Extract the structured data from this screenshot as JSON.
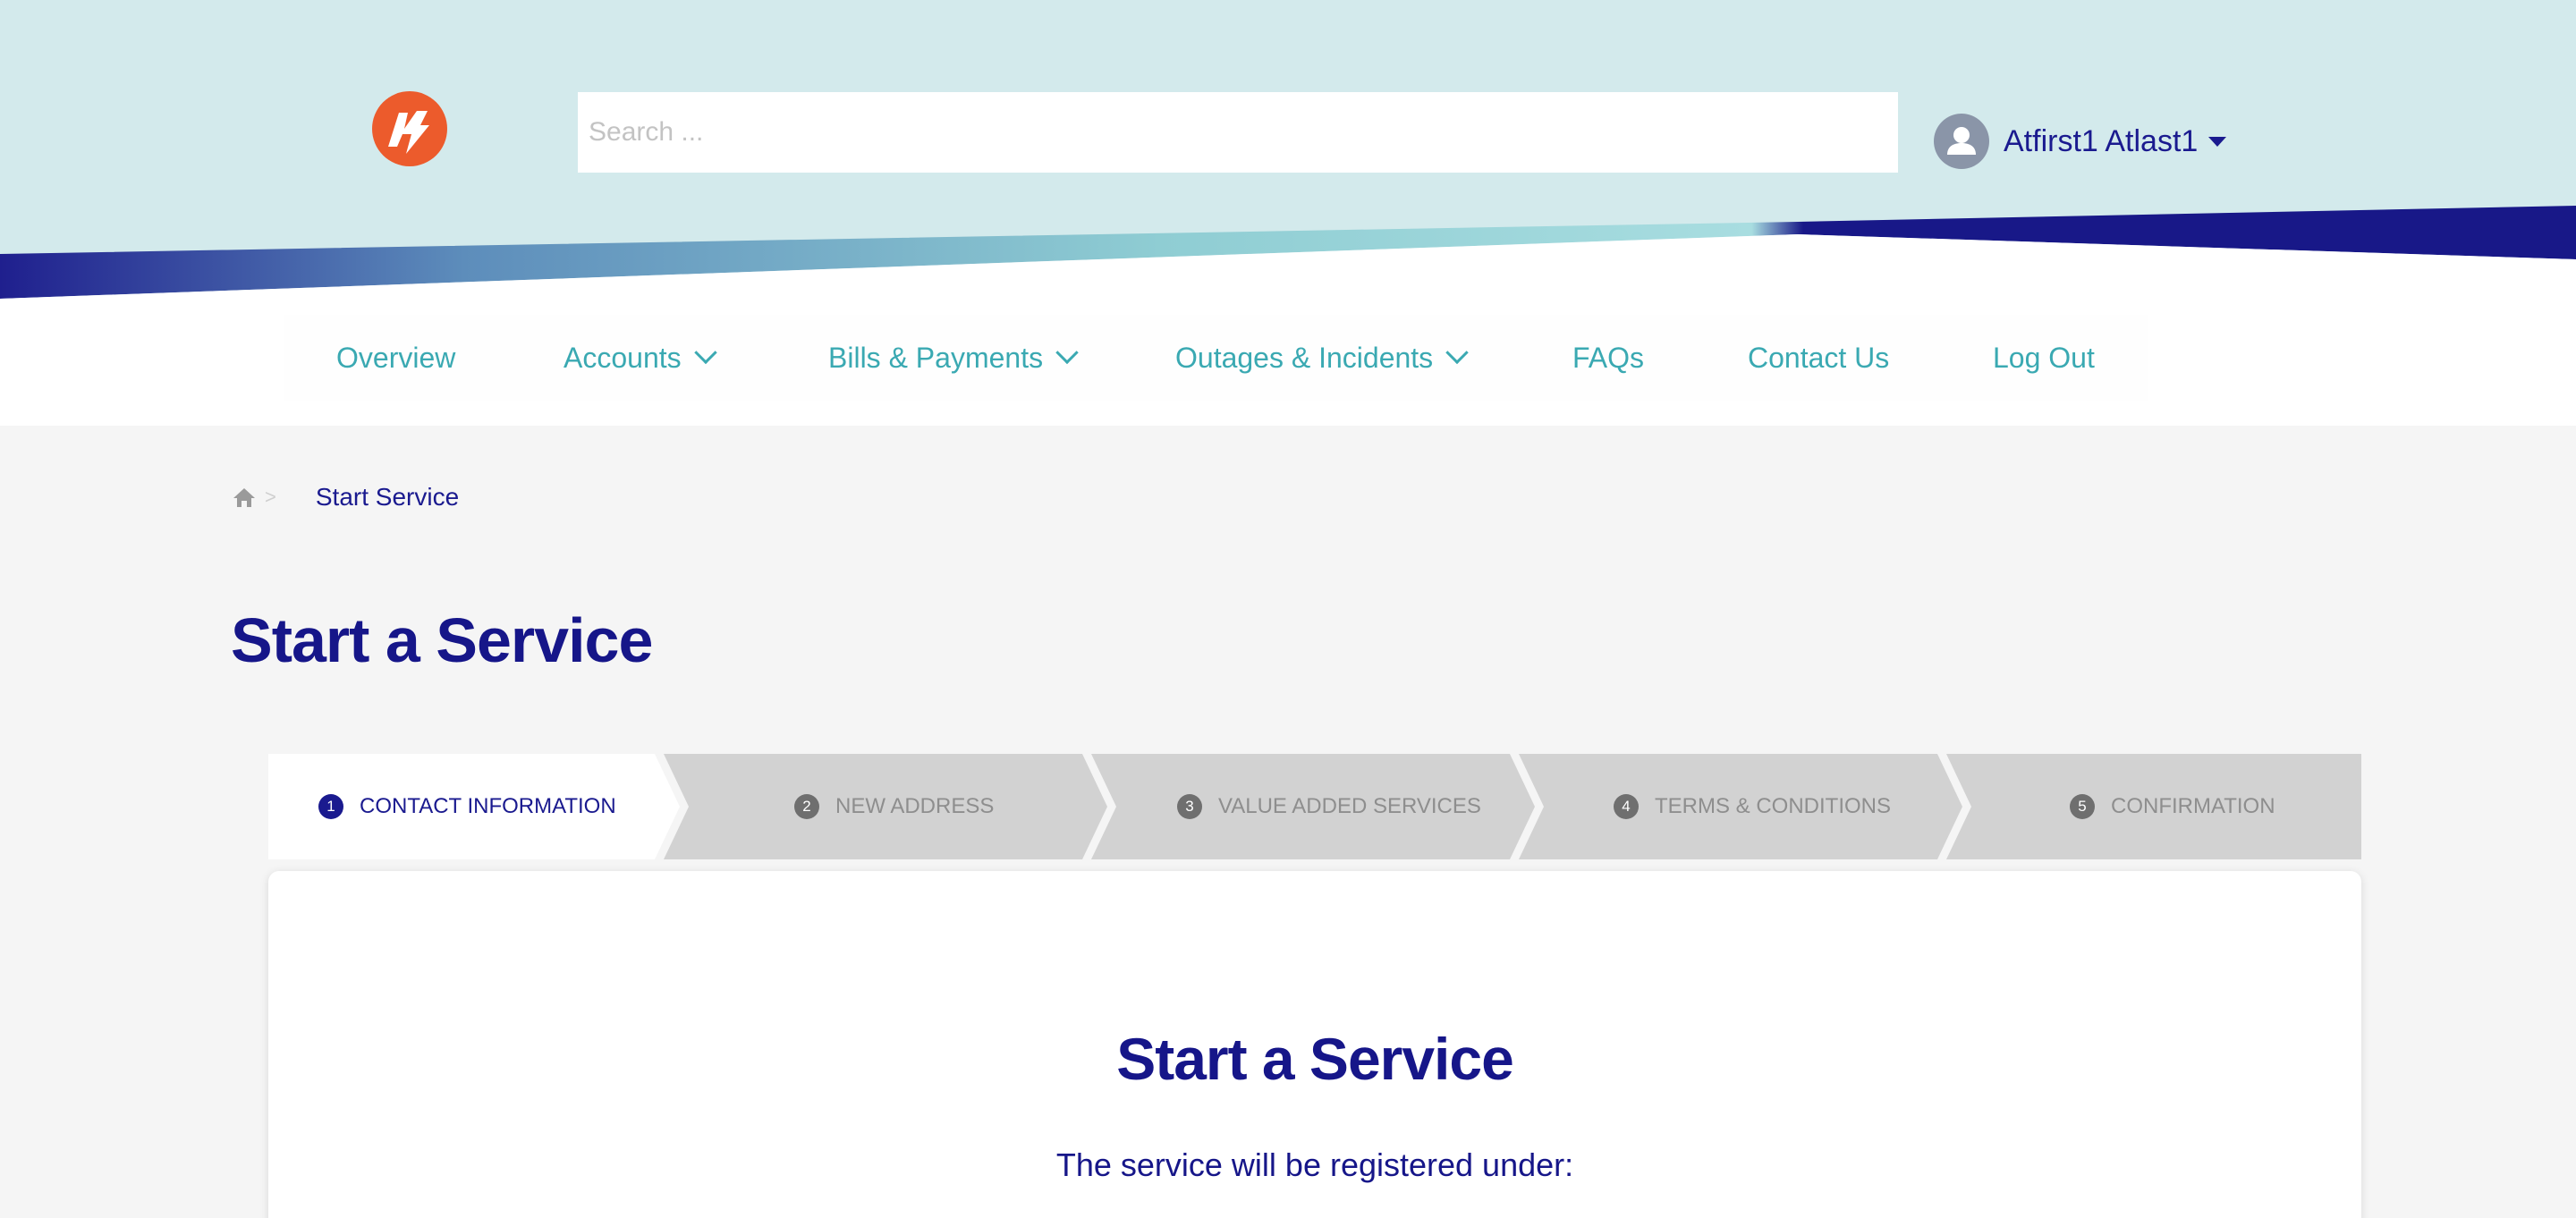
{
  "header": {
    "logo_icon": "bolt-logo-icon",
    "search_placeholder": "Search ...",
    "user_name": "Atfirst1 Atlast1",
    "colors": {
      "header_bg": "#d3eaec",
      "brand_navy": "#1a1a8f",
      "accent_teal": "#3aa9b2",
      "logo_orange": "#ec5b2c"
    }
  },
  "nav": {
    "items": [
      {
        "label": "Overview",
        "has_dropdown": false
      },
      {
        "label": "Accounts",
        "has_dropdown": true
      },
      {
        "label": "Bills & Payments",
        "has_dropdown": true
      },
      {
        "label": "Outages & Incidents",
        "has_dropdown": true
      },
      {
        "label": "FAQs",
        "has_dropdown": false
      },
      {
        "label": "Contact Us",
        "has_dropdown": false
      },
      {
        "label": "Log Out",
        "has_dropdown": false
      }
    ]
  },
  "breadcrumb": {
    "home_icon": "home-icon",
    "separator": ">",
    "current": "Start Service"
  },
  "page": {
    "title": "Start a Service"
  },
  "steps": [
    {
      "number": "1",
      "label": "CONTACT INFORMATION",
      "active": true
    },
    {
      "number": "2",
      "label": "NEW ADDRESS",
      "active": false
    },
    {
      "number": "3",
      "label": "VALUE ADDED SERVICES",
      "active": false
    },
    {
      "number": "4",
      "label": "TERMS & CONDITIONS",
      "active": false
    },
    {
      "number": "5",
      "label": "CONFIRMATION",
      "active": false
    }
  ],
  "card": {
    "title": "Start a Service",
    "subtitle": "The service will be registered under:"
  }
}
